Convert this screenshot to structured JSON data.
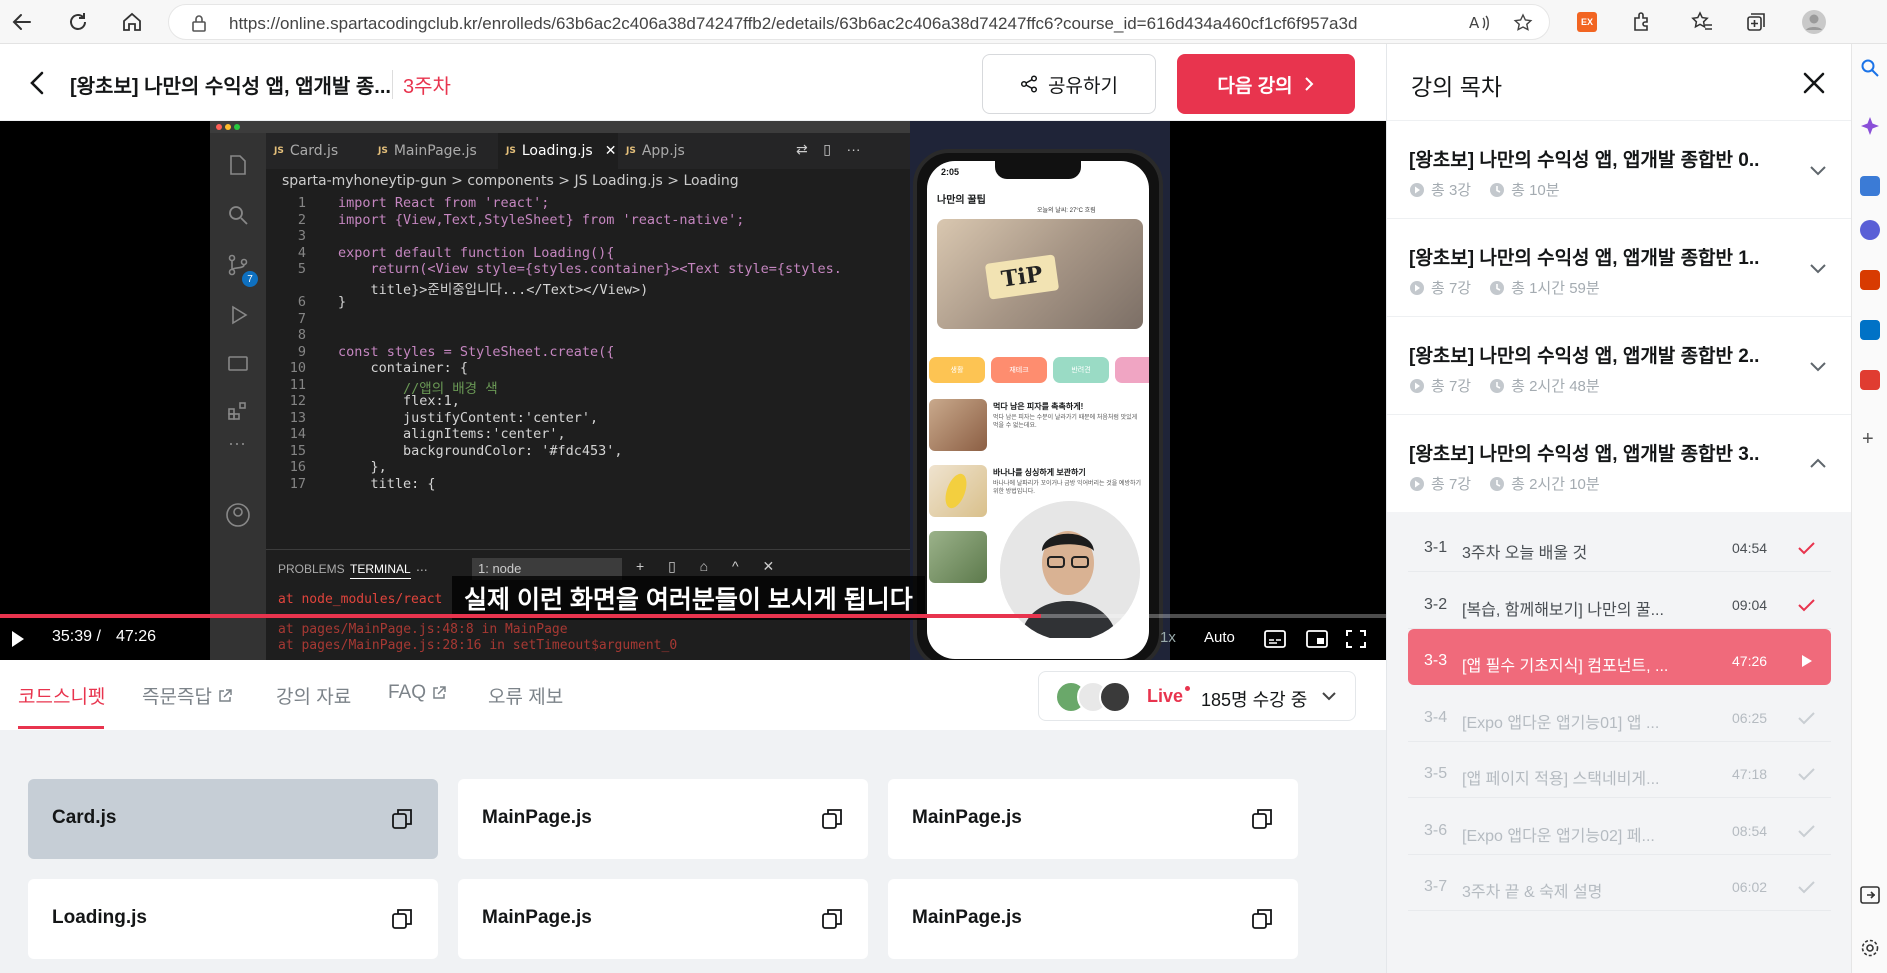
{
  "browser": {
    "url": "https://online.spartacodingclub.kr/enrolleds/63b6ac2c406a38d74247ffb2/edetails/63b6ac2c406a38d74247ffc6?course_id=616d434a460cf1cf6f957a3d",
    "ext_label": "EX"
  },
  "header": {
    "course_title": "[왕초보] 나만의 수익성 앱, 앱개발 종...",
    "week": "3주차",
    "share_label": "공유하기",
    "next_label": "다음 강의"
  },
  "video": {
    "tabs": [
      "Card.js",
      "MainPage.js",
      "Loading.js",
      "App.js"
    ],
    "breadcrumb": "sparta-myhoneytip-gun  >  components  >  JS Loading.js  >  Loading",
    "code_lines": [
      {
        "n": "1",
        "t": "import React from 'react';"
      },
      {
        "n": "2",
        "t": "import {View,Text,StyleSheet} from 'react-native';"
      },
      {
        "n": "3",
        "t": ""
      },
      {
        "n": "4",
        "t": "export default function Loading(){"
      },
      {
        "n": "5",
        "t": "    return(<View style={styles.container}><Text style={styles."
      },
      {
        "n": "",
        "t": "    title}>준비중입니다...</Text></View>)"
      },
      {
        "n": "6",
        "t": "}"
      },
      {
        "n": "7",
        "t": ""
      },
      {
        "n": "8",
        "t": ""
      },
      {
        "n": "9",
        "t": "const styles = StyleSheet.create({"
      },
      {
        "n": "10",
        "t": "    container: {"
      },
      {
        "n": "11",
        "t": "        //앱의 배경 색"
      },
      {
        "n": "12",
        "t": "        flex:1,"
      },
      {
        "n": "13",
        "t": "        justifyContent:'center',"
      },
      {
        "n": "14",
        "t": "        alignItems:'center',"
      },
      {
        "n": "15",
        "t": "        backgroundColor: '#fdc453',"
      },
      {
        "n": "16",
        "t": "    },"
      },
      {
        "n": "17",
        "t": "    title: {"
      }
    ],
    "terminal_tabs": [
      "PROBLEMS",
      "TERMINAL",
      "..."
    ],
    "terminal_select": "1: node",
    "terminal_lines": [
      "at node_modules/react",
      "at pages/MainPage.js:48:8 in MainPage",
      "at pages/MainPage.js:28:16 in setTimeout$argument_0"
    ],
    "scm_badge": "7",
    "phone": {
      "time": "2:05",
      "app_title": "나만의 꿀팁",
      "weather": "오늘의 날씨: 27°C 흐림",
      "chips": [
        "생활",
        "재테크",
        "반려견"
      ],
      "items": [
        {
          "title": "먹다 남은 피자를 촉촉하게!",
          "desc": "먹다 남은 피자는 수분이 날라가기 때문에 처음처럼 맛있게 먹을 수 없는데요."
        },
        {
          "title": "바나나를 싱싱하게 보관하기",
          "desc": "바나나에 날파리가 꼬이거나 금방 익어버리는 것을 예방하기 위한 방법입니다."
        }
      ]
    },
    "caption": "실제 이런 화면을 여러분들이 보시게 됩니다",
    "time_current": "35:39 /",
    "time_total": "47:26",
    "progress": 0.751,
    "speed": "1x",
    "quality": "Auto"
  },
  "subtabs": [
    {
      "label": "코드스니펫",
      "active": true
    },
    {
      "label": "즉문즉답",
      "external": true
    },
    {
      "label": "강의 자료"
    },
    {
      "label": "FAQ",
      "external": true
    },
    {
      "label": "오류 제보"
    }
  ],
  "live": {
    "label": "Live",
    "count": "185명 수강 중"
  },
  "snippets": [
    "Card.js",
    "MainPage.js",
    "MainPage.js",
    "Loading.js",
    "MainPage.js",
    "MainPage.js"
  ],
  "sidebar": {
    "title": "강의 목차",
    "chapters": [
      {
        "title": "[왕초보] 나만의 수익성 앱, 앱개발 종합반 0...",
        "count": "총 3강",
        "time": "총 10분",
        "expanded": false
      },
      {
        "title": "[왕초보] 나만의 수익성 앱, 앱개발 종합반 1...",
        "count": "총 7강",
        "time": "총 1시간 59분",
        "expanded": false
      },
      {
        "title": "[왕초보] 나만의 수익성 앱, 앱개발 종합반 2...",
        "count": "총 7강",
        "time": "총 2시간 48분",
        "expanded": false
      },
      {
        "title": "[왕초보] 나만의 수익성 앱, 앱개발 종합반 3...",
        "count": "총 7강",
        "time": "총 2시간 10분",
        "expanded": true
      }
    ],
    "lessons": [
      {
        "num": "3-1",
        "name": "3주차 오늘 배울 것",
        "dur": "04:54",
        "state": "done"
      },
      {
        "num": "3-2",
        "name": "[복습, 함께해보기] 나만의 꿀...",
        "dur": "09:04",
        "state": "done"
      },
      {
        "num": "3-3",
        "name": "[앱 필수 기초지식] 컴포넌트, ...",
        "dur": "47:26",
        "state": "current"
      },
      {
        "num": "3-4",
        "name": "[Expo 앱다운 앱기능01] 앱 ...",
        "dur": "06:25",
        "state": "todo"
      },
      {
        "num": "3-5",
        "name": "[앱 페이지 적용] 스택네비게...",
        "dur": "47:18",
        "state": "todo"
      },
      {
        "num": "3-6",
        "name": "[Expo 앱다운 앱기능02] 페...",
        "dur": "08:54",
        "state": "todo"
      },
      {
        "num": "3-7",
        "name": "3주차 끝 & 숙제 설명",
        "dur": "06:02",
        "state": "todo"
      }
    ]
  },
  "colors": {
    "accent": "#e8344e",
    "current_lesson": "#f06a7b",
    "snippet_selected": "#c6ced6"
  }
}
